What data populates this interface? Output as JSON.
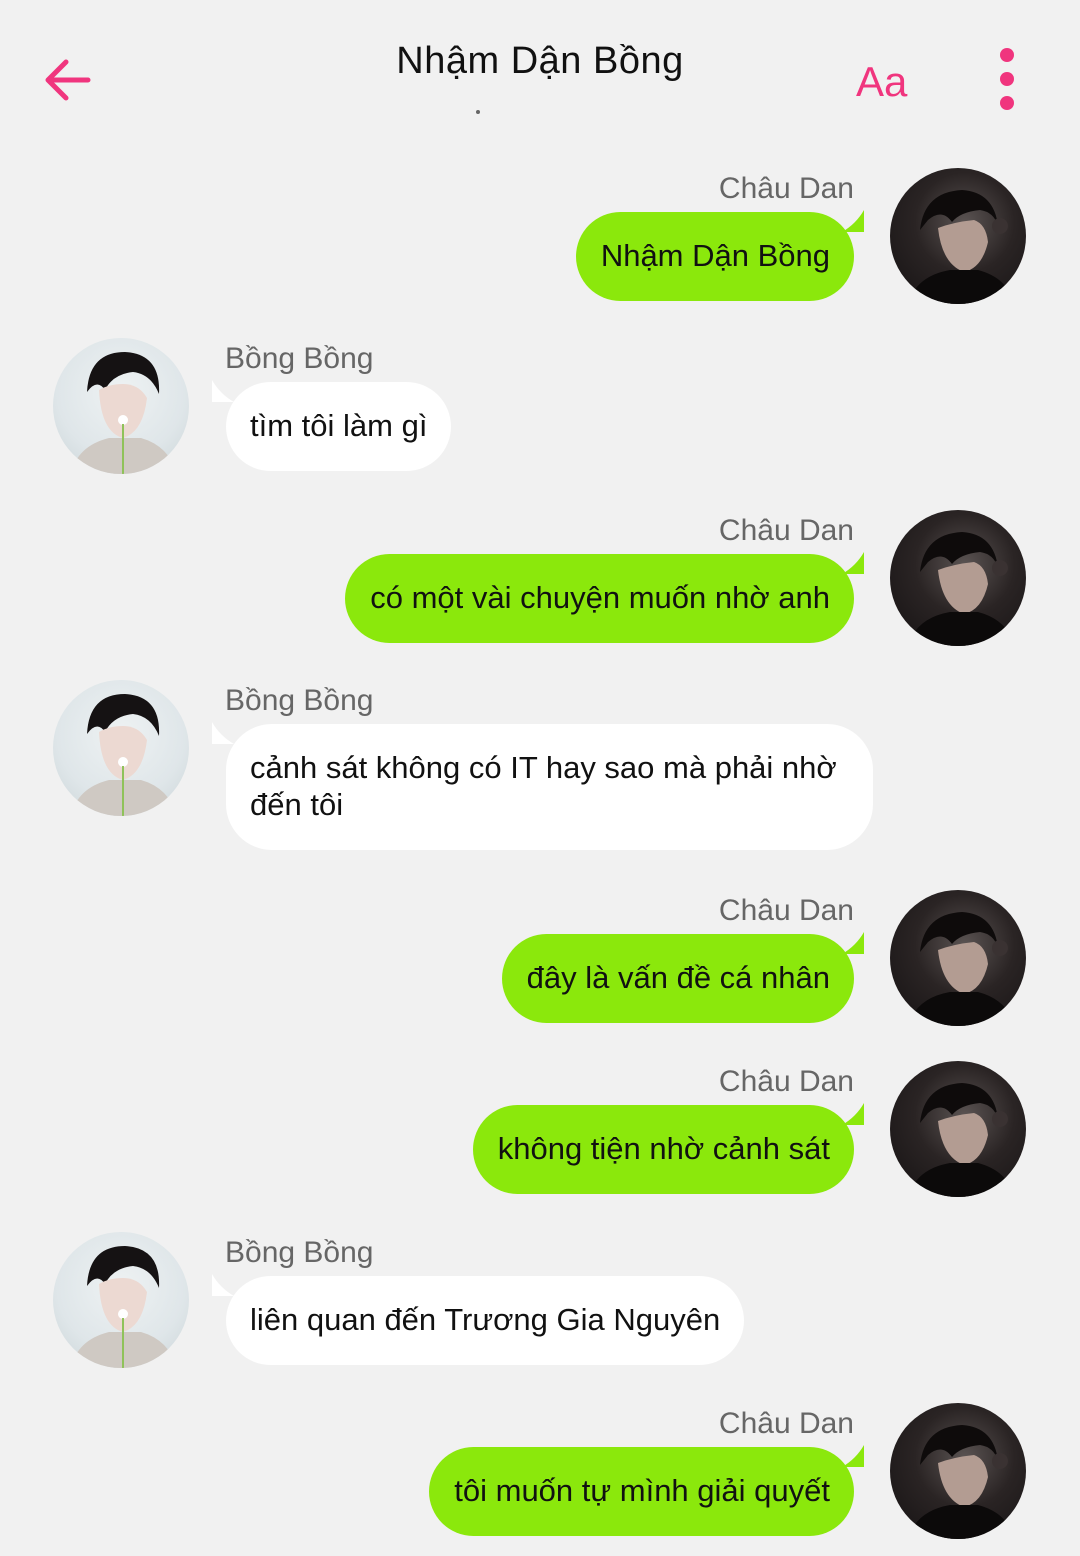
{
  "header": {
    "title": "Nhậm Dận Bồng",
    "font_button": "Aa",
    "accent_color": "#f0357e",
    "back_icon": "arrow-left-icon",
    "menu_icon": "more-vertical-icon"
  },
  "colors": {
    "background": "#f1f1f1",
    "outgoing_bubble": "#8be80c",
    "incoming_bubble": "#ffffff"
  },
  "messages": [
    {
      "direction": "outgoing",
      "sender": "Châu Dan",
      "text": "Nhậm Dận Bồng"
    },
    {
      "direction": "incoming",
      "sender": "Bồng Bồng",
      "text": "tìm tôi làm gì"
    },
    {
      "direction": "outgoing",
      "sender": "Châu Dan",
      "text": "có một vài chuyện muốn nhờ anh"
    },
    {
      "direction": "incoming",
      "sender": "Bồng Bồng",
      "text": "cảnh sát không có IT hay sao mà phải nhờ đến tôi"
    },
    {
      "direction": "outgoing",
      "sender": "Châu Dan",
      "text": "đây là vấn đề cá nhân"
    },
    {
      "direction": "outgoing",
      "sender": "Châu Dan",
      "text": "không tiện nhờ cảnh sát"
    },
    {
      "direction": "incoming",
      "sender": "Bồng Bồng",
      "text": "liên quan đến Trương Gia Nguyên"
    },
    {
      "direction": "outgoing",
      "sender": "Châu Dan",
      "text": "tôi muốn tự mình giải quyết"
    }
  ]
}
